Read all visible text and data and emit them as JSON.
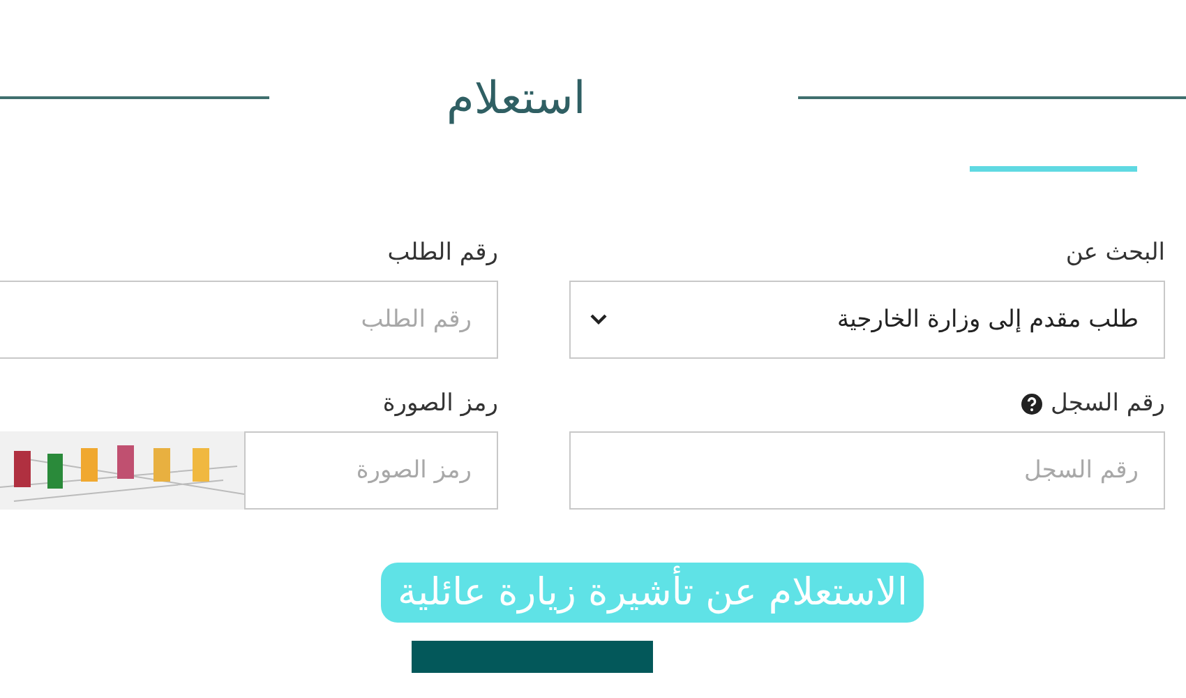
{
  "heading": {
    "title": "استعلام"
  },
  "fields": [
    {
      "kind": "select",
      "label": "البحث عن",
      "value": "طلب مقدم إلى وزارة الخارجية",
      "help": false
    },
    {
      "kind": "text",
      "label": "رقم الطلب",
      "placeholder": "رقم الطلب",
      "help": false
    },
    {
      "kind": "text",
      "label": "رقم السجل",
      "placeholder": "رقم السجل",
      "help": true
    },
    {
      "kind": "captcha",
      "label": "رمز الصورة",
      "placeholder": "رمز الصورة",
      "help": false
    }
  ],
  "caption": "الاستعلام عن تأشيرة زيارة عائلية"
}
